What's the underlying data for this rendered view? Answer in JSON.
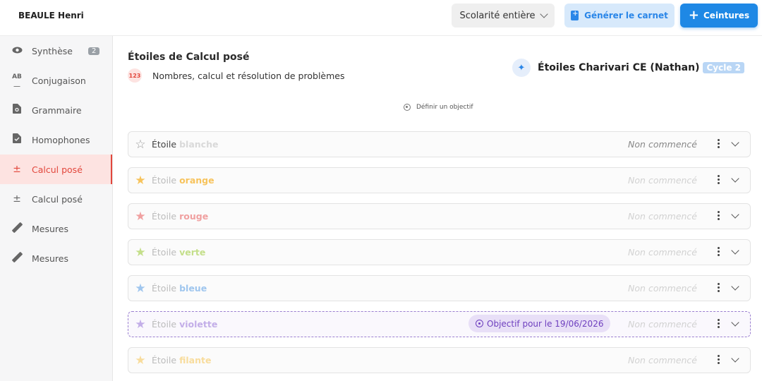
{
  "header": {
    "student_name": "BEAULE Henri",
    "period_label": "Scolarité entière",
    "generate_button": "Générer le carnet",
    "belts_button": "Ceintures",
    "accent_color": "#1e88e5"
  },
  "sidebar": {
    "items": [
      {
        "label": "Synthèse",
        "icon": "eye-icon",
        "badge": "2"
      },
      {
        "label": "Conjugaison",
        "icon": "ab-text-icon"
      },
      {
        "label": "Grammaire",
        "icon": "document-search-icon"
      },
      {
        "label": "Homophones",
        "icon": "document-check-icon"
      },
      {
        "label": "Calcul posé",
        "icon": "plus-minus-icon",
        "active": true
      },
      {
        "label": "Calcul posé",
        "icon": "plus-minus-icon"
      },
      {
        "label": "Mesures",
        "icon": "ruler-icon"
      },
      {
        "label": "Mesures",
        "icon": "ruler-icon"
      }
    ]
  },
  "main": {
    "title": "Étoiles de Calcul posé",
    "domain_label": "Nombres, calcul et résolution de problèmes",
    "method_label": "Étoiles Charivari CE (Nathan)",
    "cycle_badge": "Cycle 2",
    "define_objective": "Définir un objectif",
    "stars": [
      {
        "prefix": "Étoile",
        "color_name": "blanche",
        "color": "#d9d9d9",
        "status": "Non commencé"
      },
      {
        "prefix": "Étoile",
        "color_name": "orange",
        "color": "#f7c35c",
        "status": "Non commencé"
      },
      {
        "prefix": "Étoile",
        "color_name": "rouge",
        "color": "#f0a0a0",
        "status": "Non commencé"
      },
      {
        "prefix": "Étoile",
        "color_name": "verte",
        "color": "#c4df8a",
        "status": "Non commencé"
      },
      {
        "prefix": "Étoile",
        "color_name": "bleue",
        "color": "#9fc6ee",
        "status": "Non commencé"
      },
      {
        "prefix": "Étoile",
        "color_name": "violette",
        "color": "#c3aee8",
        "status": "Non commencé",
        "objective": "Objectif pour le 19/06/2026"
      },
      {
        "prefix": "Étoile",
        "color_name": "filante",
        "color": "#f8dc9c",
        "status": "Non commencé"
      }
    ]
  }
}
